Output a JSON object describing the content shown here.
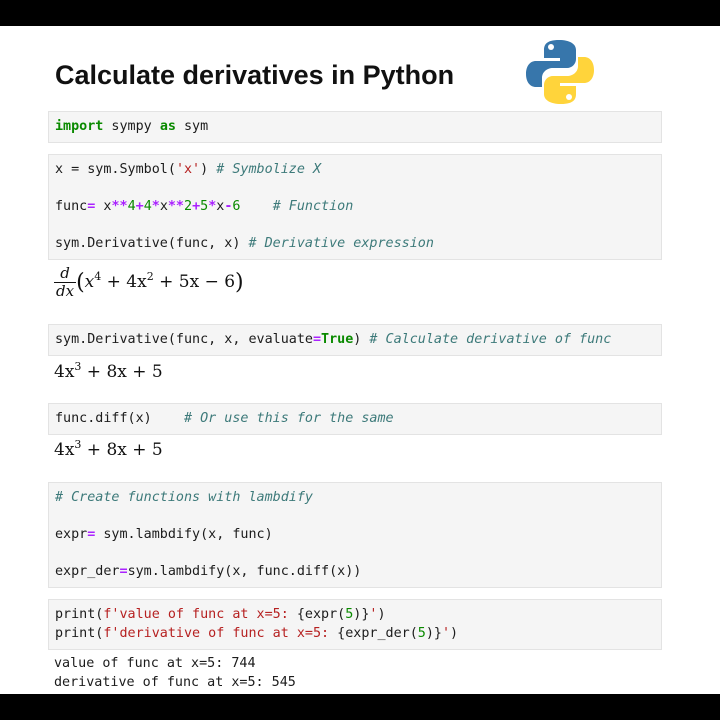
{
  "title": "Calculate derivatives in Python",
  "logo": {
    "icon": "python-logo-icon",
    "colors": [
      "#3776ab",
      "#ffd43b"
    ]
  },
  "cell1": {
    "kw_import": "import",
    "t1": " sympy ",
    "kw_as": "as",
    "t2": " sym"
  },
  "cell2": {
    "line1": {
      "code": "x = sym.Symbol(",
      "str": "'x'",
      "close": ") ",
      "comment": "# Symbolize X"
    },
    "line2": {
      "a": "func",
      "op1": "=",
      "b": " x",
      "op2": "**",
      "n1": "4",
      "op3": "+",
      "n2": "4",
      "op4": "*",
      "c": "x",
      "op5": "**",
      "n3": "2",
      "op6": "+",
      "n4": "5",
      "op7": "*",
      "d": "x",
      "op8": "-",
      "n5": "6",
      "pad": "    ",
      "comment": "# Function"
    },
    "line3": {
      "code": "sym.Derivative(func, x) ",
      "comment": "# Derivative expression"
    }
  },
  "out2": {
    "frac_num": "d",
    "frac_den": "dx",
    "expr_open": "(",
    "expr": "x",
    "e4": "4",
    "mid": " + 4x",
    "e2": "2",
    "tail": " + 5x − 6",
    "expr_close": ")"
  },
  "cell3": {
    "code": "sym.Derivative(func, x, evaluate",
    "op": "=",
    "kw": "True",
    "close": ") ",
    "comment": "# Calculate derivative of func"
  },
  "out3": {
    "a": "4x",
    "e": "3",
    "b": " + 8x + 5"
  },
  "cell4": {
    "code": "func.diff(x)",
    "pad": "    ",
    "comment": "# Or use this for the same"
  },
  "out4": {
    "a": "4x",
    "e": "3",
    "b": " + 8x + 5"
  },
  "cell5": {
    "comment": "# Create functions with lambdify",
    "line2": {
      "a": "expr",
      "op": "=",
      "b": " sym.lambdify(x, func)"
    },
    "line3": {
      "a": "expr_der",
      "op": "=",
      "b": "sym.lambdify(x, func.diff(x))"
    }
  },
  "cell6": {
    "line1": {
      "a": "print(",
      "s1": "f'value of func at x=5: ",
      "b": "{expr(",
      "n": "5",
      "c": ")}",
      "s2": "'",
      "d": ")"
    },
    "line2": {
      "a": "print(",
      "s1": "f'derivative of func at x=5: ",
      "b": "{expr_der(",
      "n": "5",
      "c": ")}",
      "s2": "'",
      "d": ")"
    }
  },
  "out6": {
    "line1": "value of func at x=5: 744",
    "line2": "derivative of func at x=5: 545"
  }
}
